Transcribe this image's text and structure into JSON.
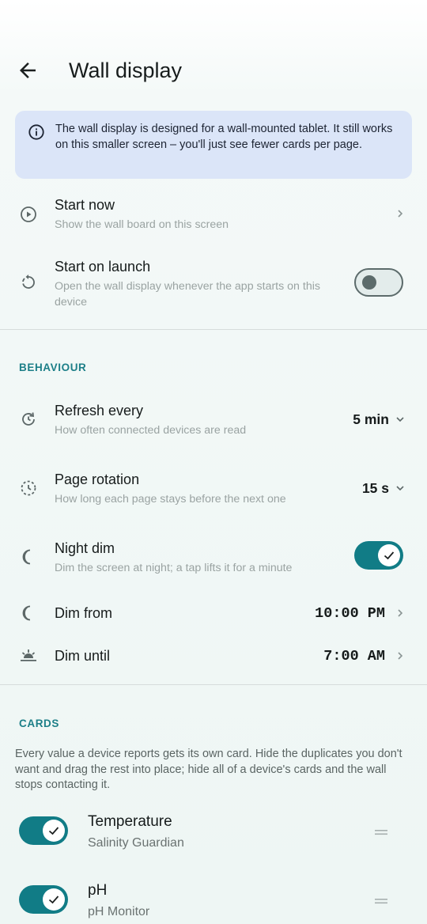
{
  "header": {
    "title": "Wall display"
  },
  "info_banner": {
    "text": "The wall display is designed for a wall-mounted tablet. It still works on this smaller screen – you'll just see fewer cards per page."
  },
  "settings": {
    "start_now": {
      "title": "Start now",
      "subtitle": "Show the wall board on this screen"
    },
    "start_on_launch": {
      "title": "Start on launch",
      "subtitle": "Open the wall display whenever the app starts on this device",
      "enabled": false
    }
  },
  "behaviour": {
    "header": "BEHAVIOUR",
    "refresh": {
      "title": "Refresh every",
      "subtitle": "How often connected devices are read",
      "value": "5 min"
    },
    "page_rotation": {
      "title": "Page rotation",
      "subtitle": "How long each page stays before the next one",
      "value": "15 s"
    },
    "night_dim": {
      "title": "Night dim",
      "subtitle": "Dim the screen at night; a tap lifts it for a minute",
      "enabled": true
    },
    "dim_from": {
      "title": "Dim from",
      "value": "10:00 PM"
    },
    "dim_until": {
      "title": "Dim until",
      "value": "7:00 AM"
    }
  },
  "cards": {
    "header": "CARDS",
    "description": "Every value a device reports gets its own card. Hide the duplicates you don't want and drag the rest into place; hide all of a device's cards and the wall stops contacting it.",
    "items": [
      {
        "title": "Temperature",
        "device": "Salinity Guardian",
        "visible": true
      },
      {
        "title": "pH",
        "device": "pH Monitor",
        "visible": true
      }
    ]
  },
  "colors": {
    "accent": "#117c86",
    "banner": "#dbe5f8",
    "section": "#1d7f88"
  }
}
